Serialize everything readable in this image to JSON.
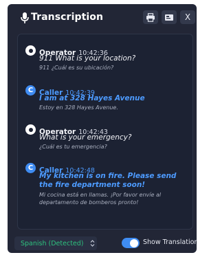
{
  "window": {
    "title": "Transcription",
    "close_label": "X"
  },
  "icons": {
    "title": "microphone-icon",
    "print": "printer-icon",
    "export": "export-icon"
  },
  "messages": [
    {
      "speaker": "Operator",
      "time": "10:42:36",
      "text": "911 What is your location?",
      "translation": "911 ¿Cuál es su ubicación?"
    },
    {
      "speaker": "Caller",
      "time": "10:42:39",
      "text": "I am at 328 Hayes Avenue",
      "translation": "Estoy en 328 Hayes Avenue."
    },
    {
      "speaker": "Operator",
      "time": "10:42:43",
      "text": "What is your emergency?",
      "translation": "¿Cuál es tu emergencia?"
    },
    {
      "speaker": "Caller",
      "time": "10:42:48",
      "text": "My kitchen is on fire. Please send the fire department soon!",
      "translation": "Mi cocina está en llamas. ¡Por favor envíe al departamento de bomberos pronto!"
    }
  ],
  "footer": {
    "language": "Spanish (Detected)",
    "toggle_label": "Show Translation",
    "toggle_on": true
  },
  "colors": {
    "window_bg": "#222636",
    "panel_bg": "#1c2233",
    "caller_accent": "#3f8cf2",
    "language_text": "#2ec27e"
  }
}
